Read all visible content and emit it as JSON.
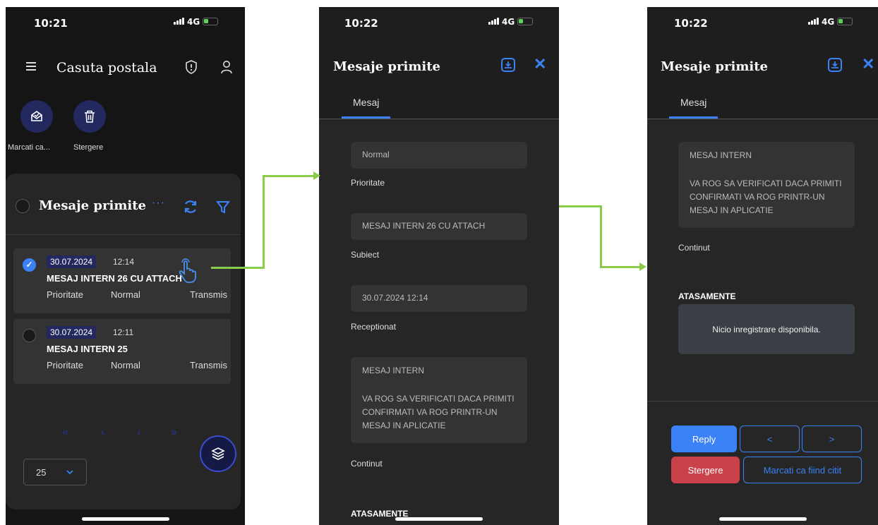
{
  "status_bars": [
    {
      "time": "10:21",
      "network": "4G"
    },
    {
      "time": "10:22",
      "network": "4G"
    },
    {
      "time": "10:22",
      "network": "4G"
    }
  ],
  "screen1": {
    "title": "Casuta postala",
    "actions": [
      {
        "label": "Marcati ca...",
        "icon": "envelope-check-icon"
      },
      {
        "label": "Stergere",
        "icon": "trash-icon"
      }
    ],
    "list_title": "Mesaje primite",
    "more_icon": "···",
    "messages": [
      {
        "date": "30.07.2024",
        "time": "12:14",
        "subject": "MESAJ INTERN 26 CU ATTACH",
        "priority_label": "Prioritate",
        "priority": "Normal",
        "status": "Transmis",
        "selected": true
      },
      {
        "date": "30.07.2024",
        "time": "12:11",
        "subject": "MESAJ INTERN 25",
        "priority_label": "Prioritate",
        "priority": "Normal",
        "status": "Transmis",
        "selected": false
      }
    ],
    "pager": {
      "first": "«",
      "prev": "‹",
      "next": "›",
      "last": "»"
    },
    "page_size": "25"
  },
  "screen2": {
    "title": "Mesaje primite",
    "tab": "Mesaj",
    "fields": [
      {
        "value": "Normal",
        "label": "Prioritate"
      },
      {
        "value": "MESAJ INTERN 26 CU ATTACH",
        "label": "Subiect"
      },
      {
        "value": "30.07.2024 12:14",
        "label": "Receptionat"
      }
    ],
    "content_heading": "MESAJ INTERN",
    "content_body": "VA ROG SA VERIFICATI DACA PRIMITI CONFIRMATI VA ROG PRINTR-UN MESAJ IN APLICATIE",
    "content_label": "Continut",
    "attachments_heading": "ATASAMENTE"
  },
  "screen3": {
    "title": "Mesaje primite",
    "tab": "Mesaj",
    "content_heading": "MESAJ INTERN",
    "content_body": "VA ROG SA VERIFICATI DACA PRIMITI CONFIRMATI VA ROG PRINTR-UN MESAJ IN APLICATIE",
    "content_label": "Continut",
    "attachments_heading": "ATASAMENTE",
    "no_records": "Nicio inregistrare disponibila.",
    "buttons": {
      "reply": "Reply",
      "prev": "<",
      "next": ">",
      "delete": "Stergere",
      "mark_read": "Marcati ca fiind citit"
    }
  },
  "colors": {
    "accent": "#3b82f6",
    "navy": "#23285e",
    "danger": "#c9424a",
    "arrow": "#8ccb4a"
  }
}
